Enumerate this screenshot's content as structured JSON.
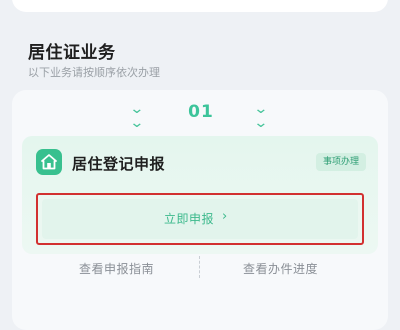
{
  "section": {
    "title": "居住证业务",
    "subtitle": "以下业务请按顺序依次办理"
  },
  "step": {
    "number": "01",
    "up_icon": "double-chevron-down-icon",
    "down_icon": "double-chevron-down-icon"
  },
  "item": {
    "icon": "house-icon",
    "title": "居住登记申报",
    "badge": "事项办理",
    "apply_label": "立即申报",
    "apply_chevron": "›"
  },
  "links": {
    "guide": "查看申报指南",
    "progress": "查看办件进度"
  },
  "colors": {
    "accent": "#3cc49a",
    "highlight_border": "#d23030",
    "background": "#eef1f5"
  }
}
